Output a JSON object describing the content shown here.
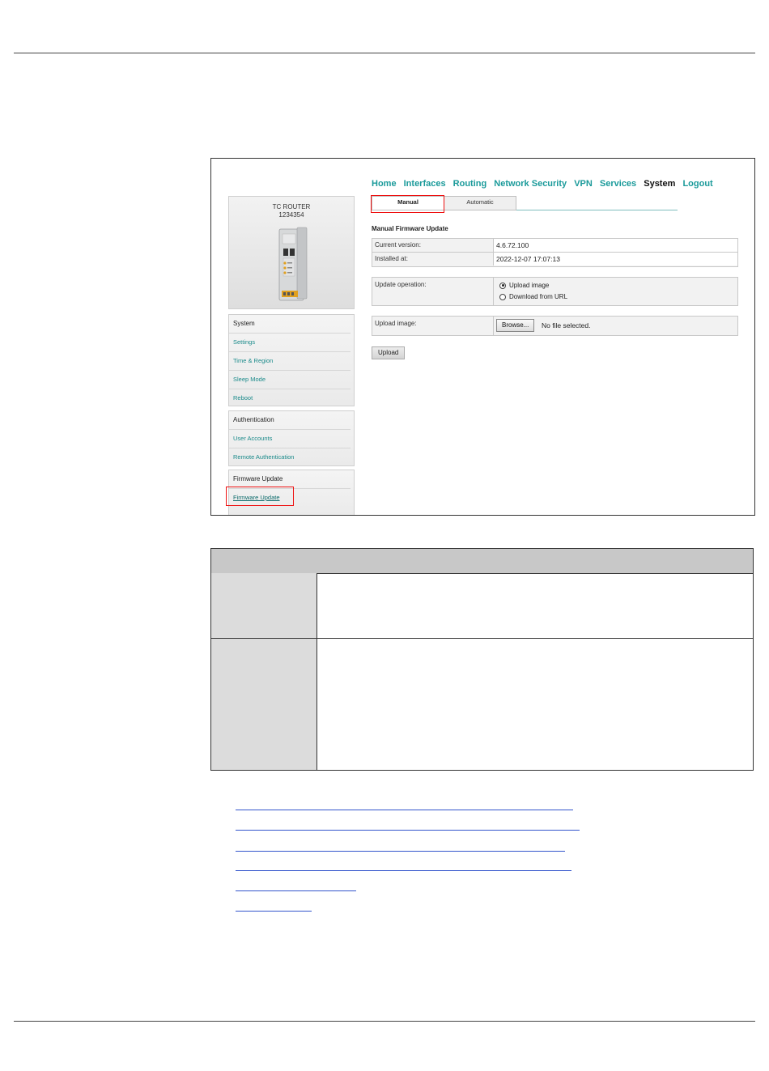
{
  "device": {
    "name": "TC ROUTER",
    "serial": "1234354"
  },
  "nav": {
    "items": [
      "Home",
      "Interfaces",
      "Routing",
      "Network Security",
      "VPN",
      "Services",
      "System",
      "Logout"
    ],
    "active": "System"
  },
  "tabs": {
    "manual": "Manual",
    "automatic": "Automatic",
    "active": "Manual"
  },
  "sidebar": {
    "system": {
      "heading": "System",
      "items": [
        "Settings",
        "Time & Region",
        "Sleep Mode",
        "Reboot"
      ]
    },
    "authentication": {
      "heading": "Authentication",
      "items": [
        "User Accounts",
        "Remote Authentication"
      ]
    },
    "firmware": {
      "heading": "Firmware Update",
      "items": [
        "Firmware Update"
      ]
    }
  },
  "main": {
    "title": "Manual Firmware Update",
    "current_version_label": "Current version:",
    "current_version_value": "4.6.72.100",
    "installed_at_label": "Installed at:",
    "installed_at_value": "2022-12-07 17:07:13",
    "update_operation_label": "Update operation:",
    "radio_upload_label": "Upload image",
    "radio_url_label": "Download from URL",
    "radio_selected": "Upload image",
    "upload_image_label": "Upload image:",
    "browse_label": "Browse...",
    "file_status": "No file selected.",
    "upload_button": "Upload"
  },
  "colors": {
    "accent": "#1a9a9a",
    "highlight": "#e11111",
    "table_header": "#c8c8c8",
    "table_key": "#dcdcdc"
  }
}
